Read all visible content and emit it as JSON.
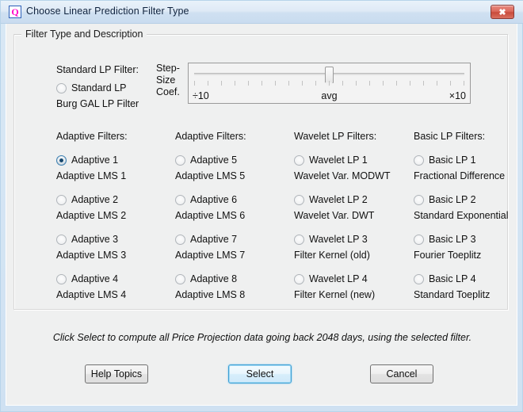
{
  "window": {
    "title": "Choose Linear Prediction Filter Type",
    "icon": "app-q-icon",
    "icon_glyph": "Q",
    "close_label": "✖"
  },
  "groupbox": {
    "title": "Filter Type and Description"
  },
  "standard": {
    "heading": "Standard LP Filter:",
    "option_label": "Standard LP",
    "option_desc": "Burg GAL LP Filter",
    "checked": false
  },
  "slider": {
    "caption_line1": "Step-",
    "caption_line2": "Size",
    "caption_line3": "Coef.",
    "left_label": "÷10",
    "center_label": "avg",
    "right_label": "×10",
    "value_percent": 50,
    "tick_count": 21
  },
  "columns": [
    {
      "heading": "Adaptive Filters:",
      "options": [
        {
          "label": "Adaptive 1",
          "desc": "Adaptive LMS 1",
          "checked": true
        },
        {
          "label": "Adaptive 2",
          "desc": "Adaptive LMS 2",
          "checked": false
        },
        {
          "label": "Adaptive 3",
          "desc": "Adaptive LMS 3",
          "checked": false
        },
        {
          "label": "Adaptive 4",
          "desc": "Adaptive LMS 4",
          "checked": false
        }
      ]
    },
    {
      "heading": "Adaptive Filters:",
      "options": [
        {
          "label": "Adaptive 5",
          "desc": "Adaptive LMS 5",
          "checked": false
        },
        {
          "label": "Adaptive 6",
          "desc": "Adaptive LMS 6",
          "checked": false
        },
        {
          "label": "Adaptive 7",
          "desc": "Adaptive LMS 7",
          "checked": false
        },
        {
          "label": "Adaptive 8",
          "desc": "Adaptive LMS 8",
          "checked": false
        }
      ]
    },
    {
      "heading": "Wavelet LP Filters:",
      "options": [
        {
          "label": "Wavelet LP 1",
          "desc": "Wavelet Var. MODWT",
          "checked": false
        },
        {
          "label": "Wavelet LP 2",
          "desc": "Wavelet Var. DWT",
          "checked": false
        },
        {
          "label": "Wavelet LP 3",
          "desc": "Filter Kernel (old)",
          "checked": false
        },
        {
          "label": "Wavelet LP 4",
          "desc": "Filter Kernel (new)",
          "checked": false
        }
      ]
    },
    {
      "heading": "Basic LP Filters:",
      "options": [
        {
          "label": "Basic LP 1",
          "desc": "Fractional Difference",
          "checked": false
        },
        {
          "label": "Basic LP 2",
          "desc": "Standard Exponential",
          "checked": false
        },
        {
          "label": "Basic LP 3",
          "desc": "Fourier Toeplitz",
          "checked": false
        },
        {
          "label": "Basic LP 4",
          "desc": "Standard Toeplitz",
          "checked": false
        }
      ]
    }
  ],
  "footer": {
    "note": "Click Select to compute all Price Projection data going back 2048 days, using the selected filter.",
    "help_label": "Help Topics",
    "select_label": "Select",
    "cancel_label": "Cancel"
  },
  "colors": {
    "accent": "#3c9fd4",
    "radio_selected": "#17486e",
    "close_red": "#c94b3c",
    "title_bg": "#cfe0f1"
  }
}
